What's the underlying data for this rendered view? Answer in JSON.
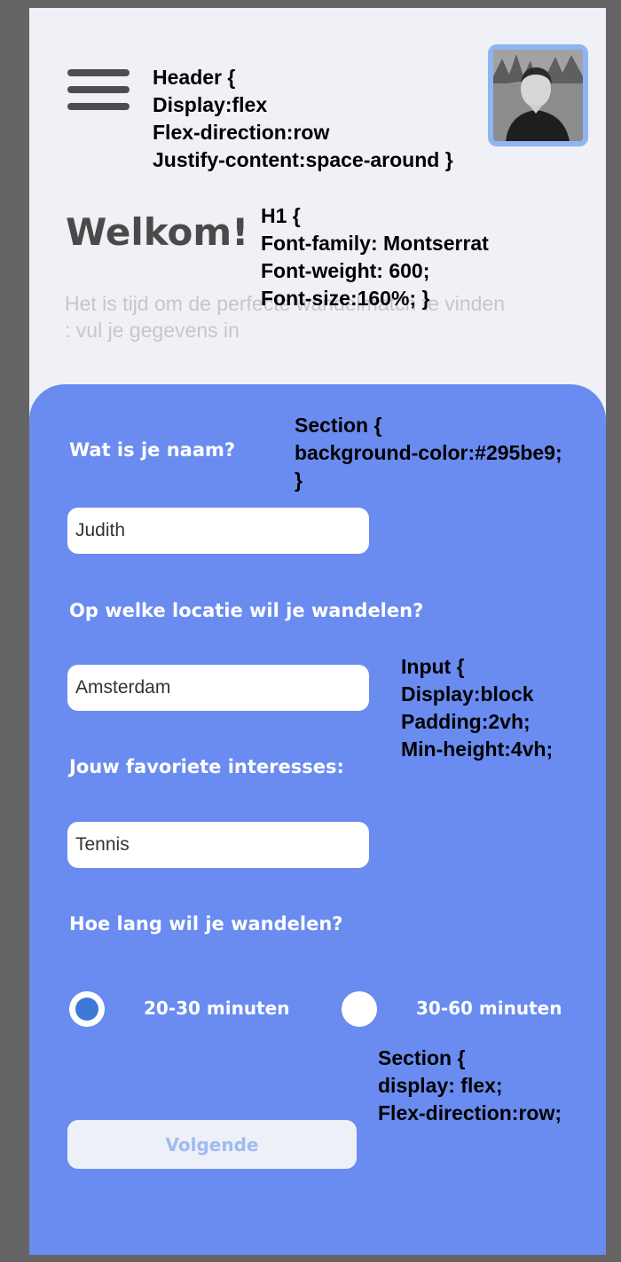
{
  "header": {
    "menu_icon": "hamburger-menu-icon",
    "avatar_alt": "profile photo"
  },
  "annotations": {
    "header_css": "Header {\nDisplay:flex\nFlex-direction:row\nJustify-content:space-around }",
    "h1_css": "H1 {\nFont-family: Montserrat\nFont-weight: 600;\nFont-size:160%; }",
    "section_css": "Section {\nbackground-color:#295be9;\n}",
    "input_css": "Input {\nDisplay:block\nPadding:2vh;\nMin-height:4vh;",
    "section_flex_css": "Section {\ndisplay: flex;\nFlex-direction:row;"
  },
  "intro": {
    "title": "Welkom!",
    "subtitle": "Het is tijd om de perfecte wandelmatch te vinden : vul je gegevens in"
  },
  "form": {
    "name_label": "Wat is je naam?",
    "name_value": "Judith",
    "location_label": "Op welke locatie wil je wandelen?",
    "location_value": "Amsterdam",
    "interests_label": "Jouw favoriete interesses:",
    "interests_value": "Tennis",
    "duration_label": "Hoe lang wil je wandelen?",
    "duration_options": [
      {
        "label": "20-30 minuten",
        "checked": true
      },
      {
        "label": "30-60 minuten",
        "checked": false
      }
    ],
    "next_label": "Volgende"
  },
  "colors": {
    "section_bg": "#6a8cf0",
    "page_bg": "#f0f1f6",
    "radio_selected": "#3d7ad8",
    "button_text": "#9dbbf2"
  }
}
